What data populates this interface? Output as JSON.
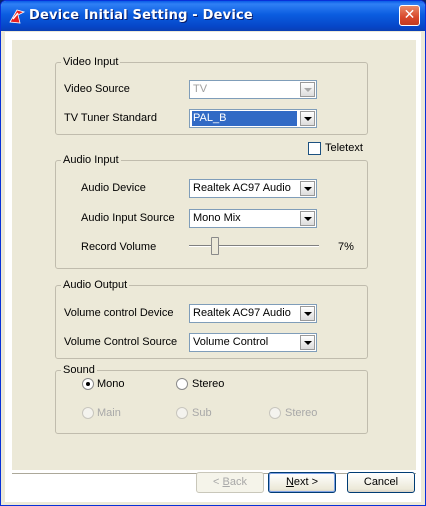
{
  "window": {
    "title": "Device Initial Setting - Device",
    "close_glyph": "✕"
  },
  "video_input": {
    "group_label": "Video Input",
    "video_source_label": "Video Source",
    "video_source_value": "TV",
    "tuner_label": "TV Tuner Standard",
    "tuner_value": "PAL_B",
    "teletext_label": "Teletext",
    "teletext_checked": false
  },
  "audio_input": {
    "group_label": "Audio Input",
    "device_label": "Audio Device",
    "device_value": "Realtek AC97 Audio",
    "source_label": "Audio Input Source",
    "source_value": "Mono Mix",
    "volume_label": "Record Volume",
    "volume_text": "7%",
    "volume_fraction": 0.07
  },
  "audio_output": {
    "group_label": "Audio Output",
    "device_label": "Volume control Device",
    "device_value": "Realtek AC97 Audio",
    "source_label": "Volume Control Source",
    "source_value": "Volume Control"
  },
  "sound": {
    "group_label": "Sound",
    "mono_label": "Mono",
    "stereo_label": "Stereo",
    "selected": "Mono",
    "main_label": "Main",
    "sub_label": "Sub",
    "stereo2_label": "Stereo"
  },
  "buttons": {
    "back_prefix": "< ",
    "back_key": "B",
    "back_rest": "ack",
    "next_key": "N",
    "next_rest": "ext >",
    "cancel": "Cancel"
  },
  "colors": {
    "titlebar": "#0a5ce6",
    "close": "#d8482a",
    "selection": "#316ac5"
  },
  "icons": [
    "app-icon",
    "close-icon",
    "chevron-down-icon"
  ]
}
